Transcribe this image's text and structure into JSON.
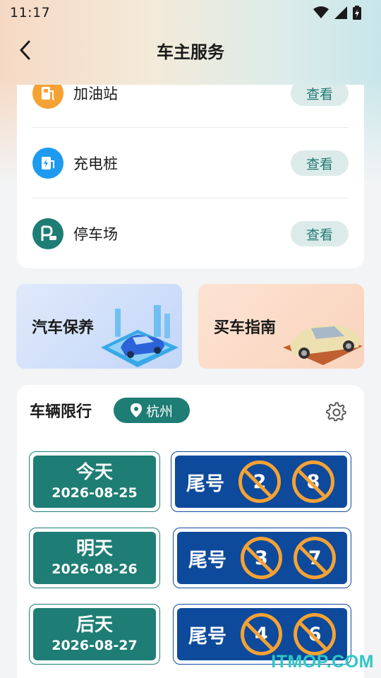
{
  "status_bar": {
    "time": "11:17"
  },
  "header": {
    "title": "车主服务"
  },
  "services": [
    {
      "label": "加油站",
      "action": "查看",
      "icon": "gas-station-icon",
      "color": "#f5a234"
    },
    {
      "label": "充电桩",
      "action": "查看",
      "icon": "charging-pile-icon",
      "color": "#1e9bf0"
    },
    {
      "label": "停车场",
      "action": "查看",
      "icon": "parking-icon",
      "color": "#1e7d74"
    }
  ],
  "banners": [
    {
      "label": "汽车保养"
    },
    {
      "label": "买车指南"
    }
  ],
  "restriction": {
    "title": "车辆限行",
    "city": "杭州",
    "plate_prefix": "尾号",
    "days": [
      {
        "name": "今天",
        "date": "2026-08-25",
        "numbers": [
          "2",
          "8"
        ]
      },
      {
        "name": "明天",
        "date": "2026-08-26",
        "numbers": [
          "3",
          "7"
        ]
      },
      {
        "name": "后天",
        "date": "2026-08-27",
        "numbers": [
          "4",
          "6"
        ]
      }
    ]
  },
  "watermark": "ITMOP.COM",
  "colors": {
    "primary": "#1e7d74",
    "plate_blue": "#0d4a9b",
    "forbid_orange": "#f5a234"
  }
}
